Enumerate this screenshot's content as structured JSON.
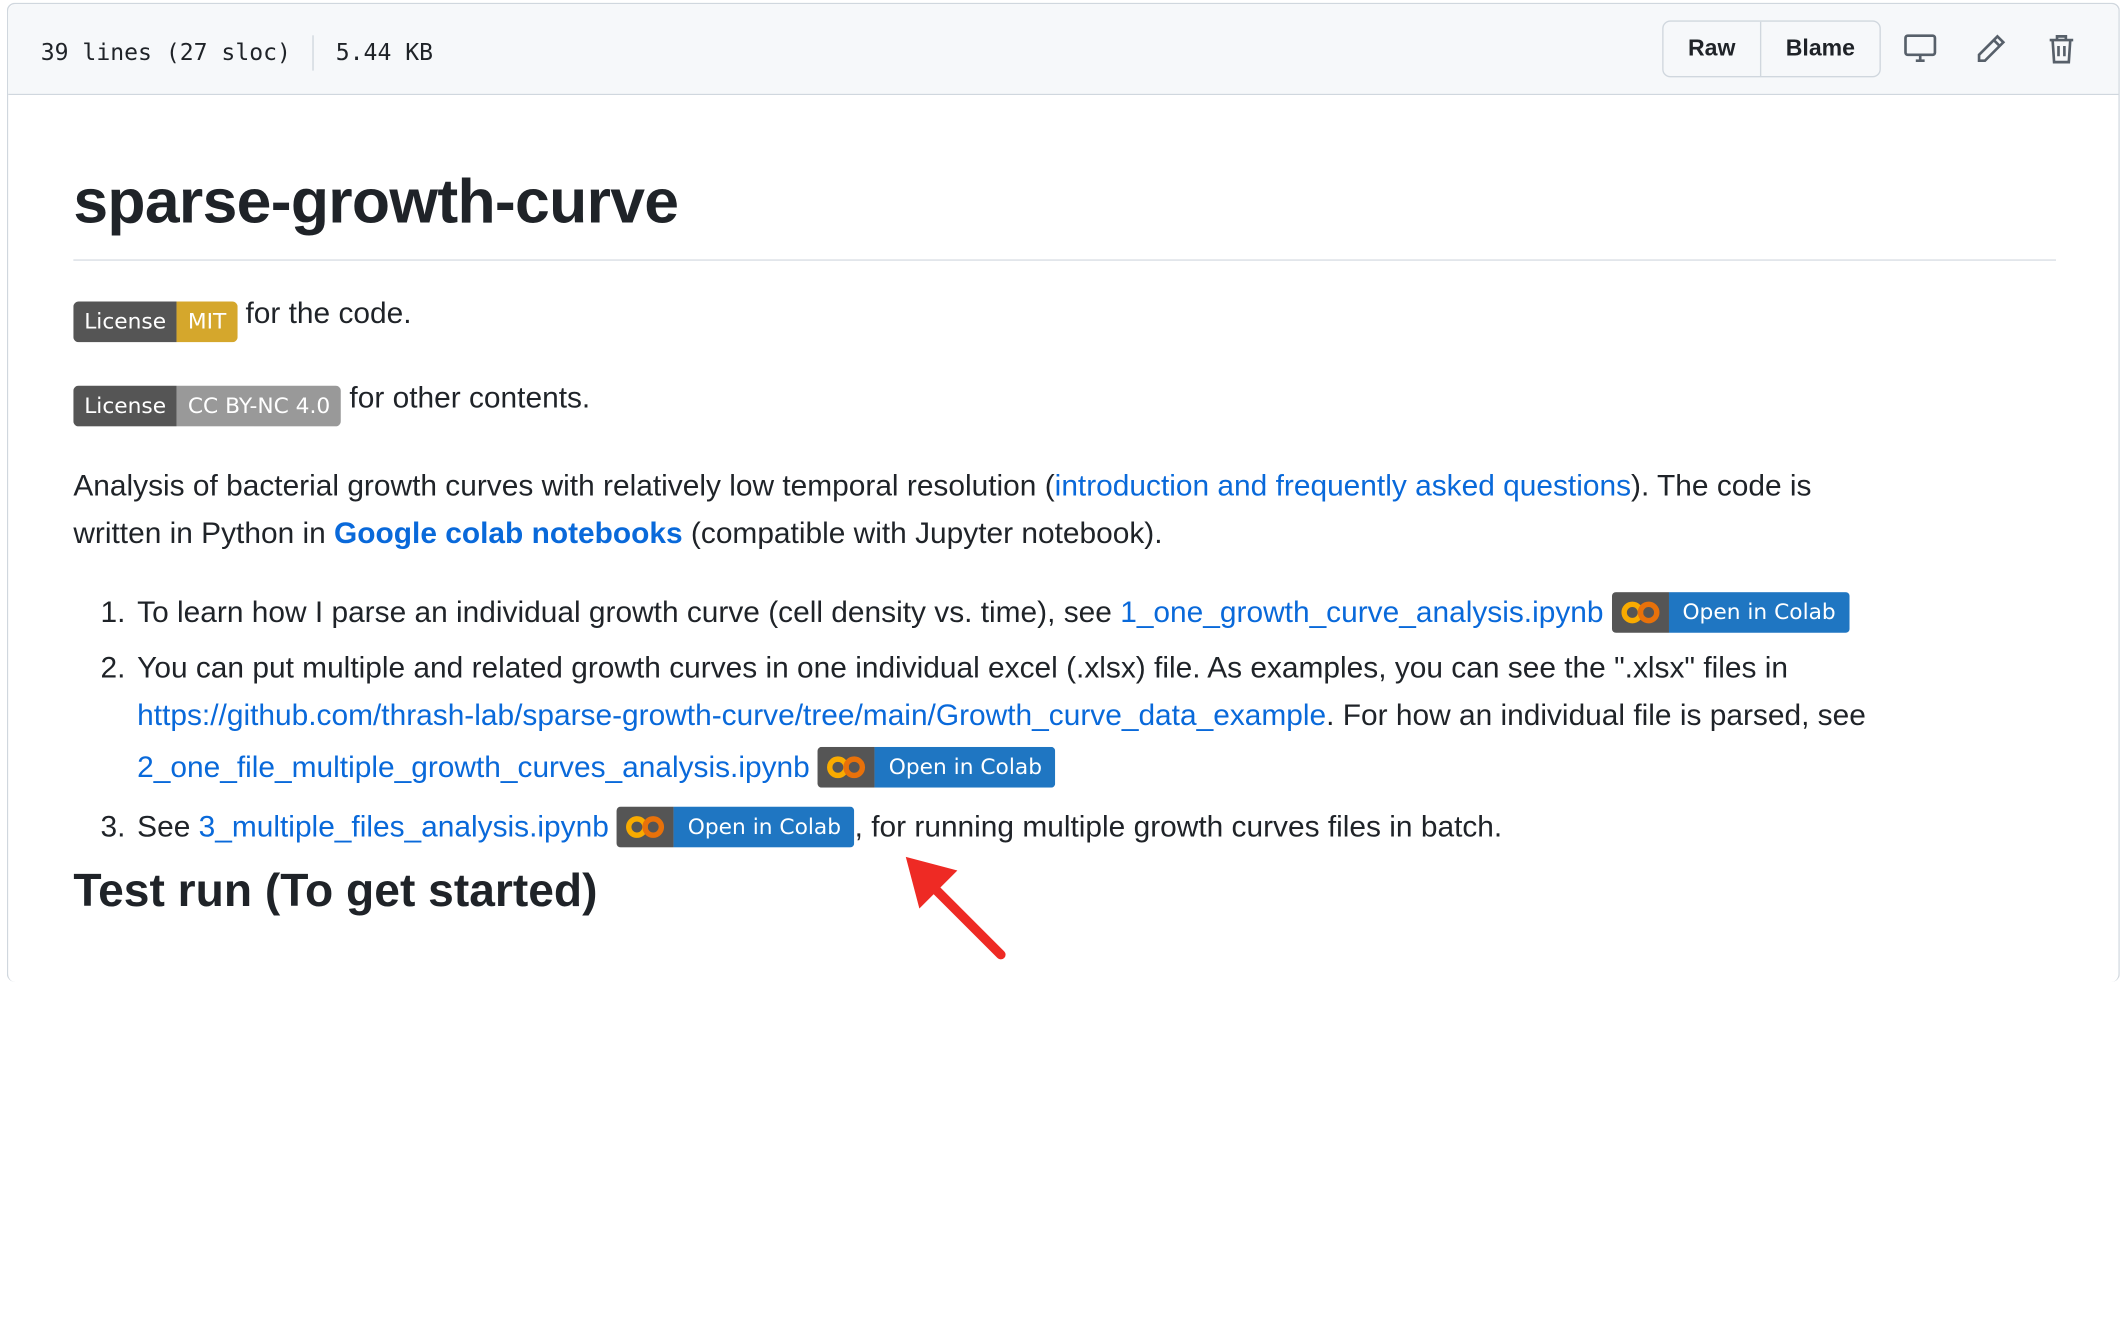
{
  "file_header": {
    "lines": "39 lines (27 sloc)",
    "size": "5.44 KB",
    "raw_label": "Raw",
    "blame_label": "Blame"
  },
  "readme": {
    "title": "sparse-growth-curve",
    "badges": [
      {
        "left": "License",
        "right": "MIT",
        "right_color": "#d5a72c",
        "after": "for the code."
      },
      {
        "left": "License",
        "right": "CC BY-NC 4.0",
        "right_color": "#999999",
        "after": "for other contents."
      }
    ],
    "intro": {
      "part1": "Analysis of bacterial growth curves with relatively low temporal resolution (",
      "link1": "introduction and frequently asked questions",
      "part2": "). The code is",
      "part3": "written in Python in ",
      "link2": "Google colab notebooks",
      "part4": " (compatible with Jupyter notebook)."
    },
    "list": [
      {
        "number": "1.",
        "text": "To learn how I parse an individual growth curve (cell density vs. time), see ",
        "link": "1_one_growth_curve_analysis.ipynb",
        "colab_label": "Open in Colab"
      },
      {
        "number": "2.",
        "line1": "You can put multiple and related growth curves in one individual excel (.xlsx) file. As examples, you can see the \".xlsx\" files in",
        "link_url": "https://github.com/thrash-lab/sparse-growth-curve/tree/main/Growth_curve_data_example",
        "line2_after": ". For how an individual file is parsed, see",
        "link": "2_one_file_multiple_growth_curves_analysis.ipynb",
        "colab_label": "Open in Colab"
      },
      {
        "number": "3.",
        "text_before": "See ",
        "link": "3_multiple_files_analysis.ipynb",
        "colab_label": "Open in Colab",
        "text_after": ", for running multiple growth curves files in batch."
      }
    ],
    "section_heading": "Test run (To get started)"
  },
  "colors": {
    "link": "#0969da",
    "colab_blue": "#1f76c2",
    "colab_orange": "#f9ab00",
    "arrow_red": "#ee2a24"
  },
  "icons": [
    "desktop-icon",
    "pencil-icon",
    "trash-icon",
    "colab-logo-icon",
    "red-arrow-annotation"
  ]
}
